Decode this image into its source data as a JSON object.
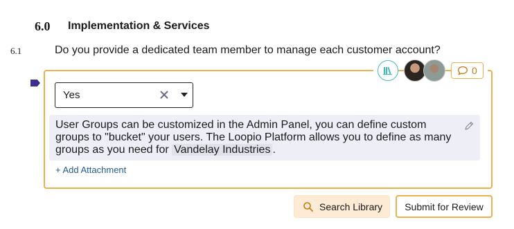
{
  "section": {
    "number": "6.0",
    "title": "Implementation & Services"
  },
  "question": {
    "number": "6.1",
    "text": "Do you provide a dedicated team member to manage each customer account?"
  },
  "toolbar": {
    "comment_count": "0"
  },
  "answer": {
    "selected_value": "Yes",
    "text_before_mention": "User Groups can be customized in the Admin Panel, you can define custom groups to \"bucket\" your users. The Loopio Platform allows you to define as many groups as you need for ",
    "mention": "Vandelay Industries",
    "text_after_mention": "."
  },
  "attachment": {
    "label": "+ Add Attachment"
  },
  "buttons": {
    "search_library": "Search Library",
    "submit_review": "Submit for Review"
  },
  "colors": {
    "accent": "#f0ae4c",
    "flag": "#3b2f8f",
    "teal": "#3fbcb8",
    "link": "#1f5c93"
  }
}
